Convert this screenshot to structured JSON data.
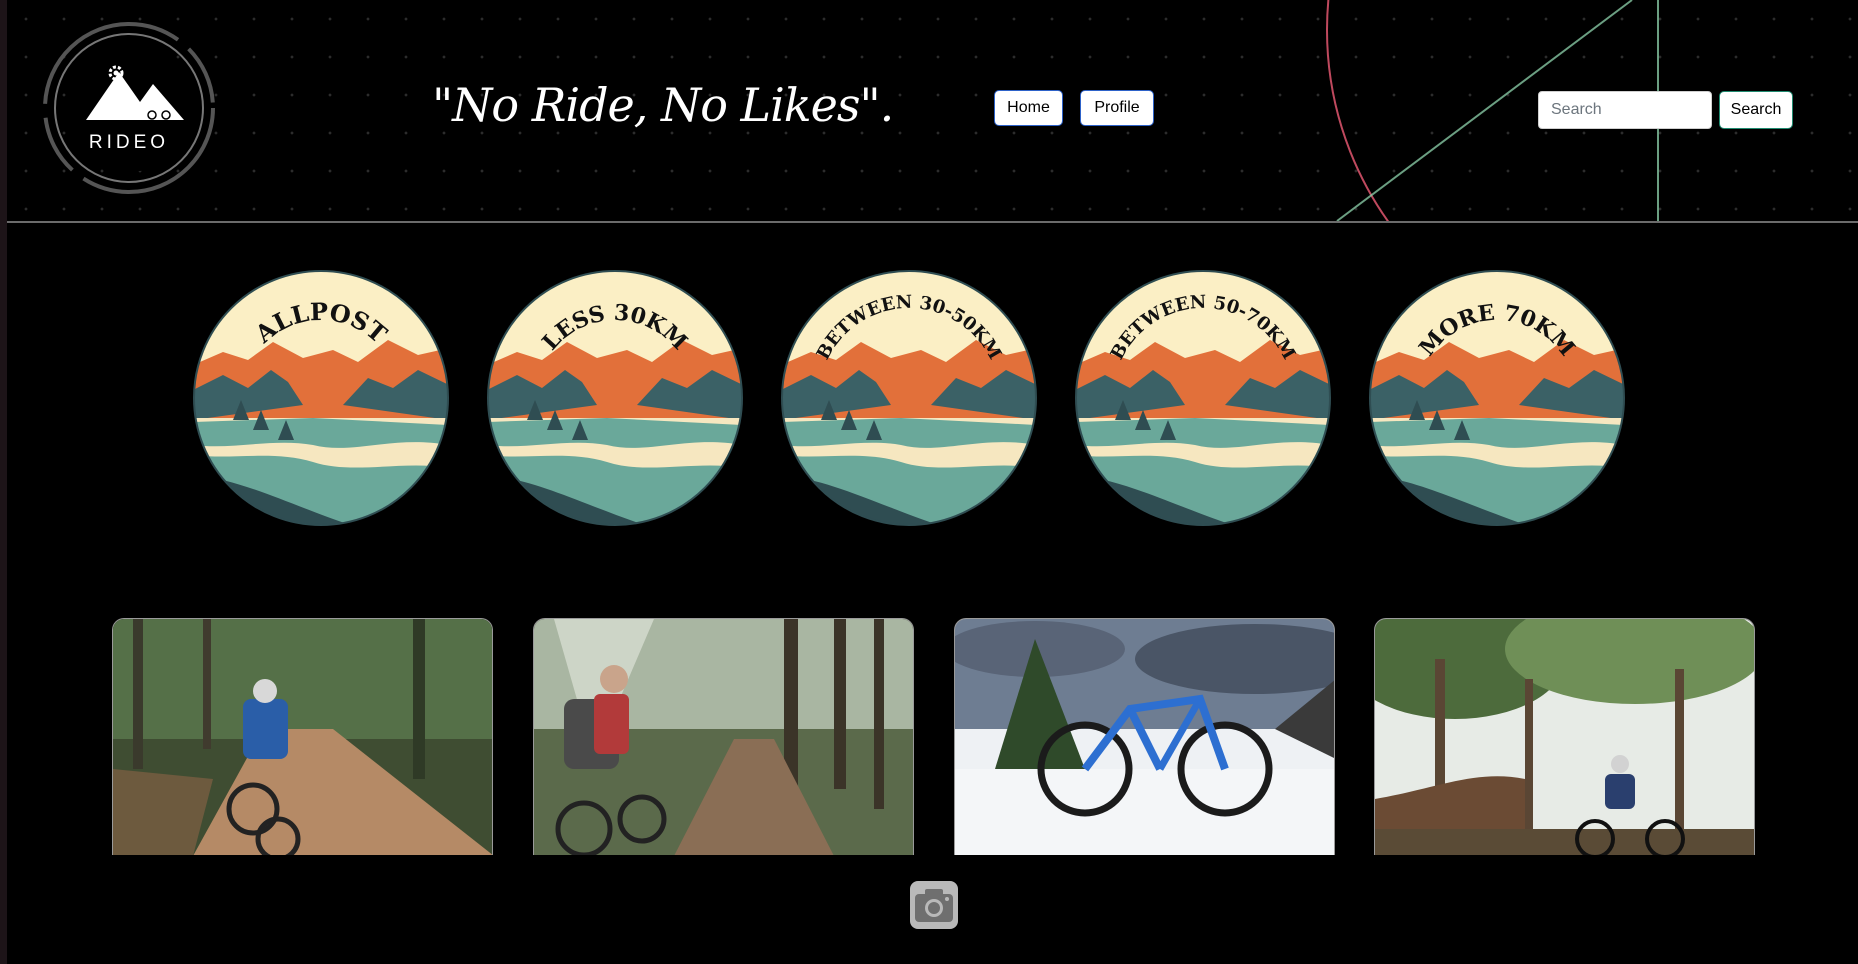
{
  "brand": {
    "logo_text": "RIDEO",
    "slogan": "\"No Ride, No Likes\"."
  },
  "nav": {
    "home_label": "Home",
    "profile_label": "Profile"
  },
  "search": {
    "placeholder": "Search",
    "value": "",
    "button_label": "Search"
  },
  "categories": [
    {
      "label": "ALLPOST"
    },
    {
      "label": "LESS 30KM"
    },
    {
      "label": "BETWEEN 30-50KM"
    },
    {
      "label": "BETWEEN 50-70KM"
    },
    {
      "label": "MORE 70KM"
    }
  ],
  "posts": [
    {
      "scene": "rider on dirt forest trail, rear view"
    },
    {
      "scene": "rider with helmet smiling on pine forest trail"
    },
    {
      "scene": "blue mountain bike standing in snow"
    },
    {
      "scene": "rider under tall trees in forest"
    }
  ],
  "footer": {
    "icon": "camera-icon"
  },
  "colors": {
    "background": "#000000",
    "badge_cream": "#fbefc5",
    "badge_orange": "#e2703a",
    "badge_teal": "#6aa89a",
    "badge_dark": "#2f4d52",
    "deco_pink": "#e0566f",
    "deco_green": "#8fd4ae"
  }
}
